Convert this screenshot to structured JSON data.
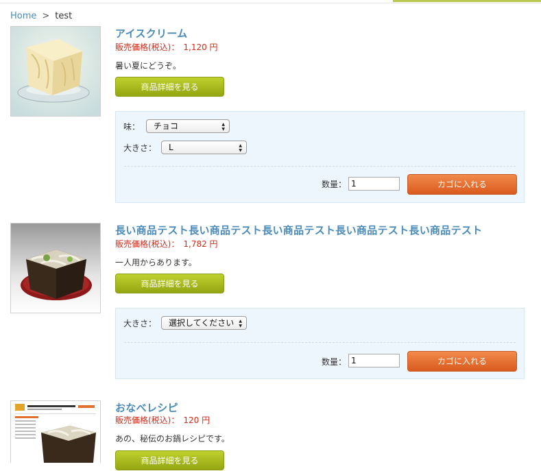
{
  "breadcrumb": {
    "home": "Home",
    "sep": ">",
    "current": "test"
  },
  "products": [
    {
      "name": "アイスクリーム",
      "price_label": "販売価格(税込)：",
      "price_value": "1,120 円",
      "description": "暑い夏にどうぞ。",
      "detail_button": "商品詳細を見る",
      "options": [
        {
          "label": "味：",
          "selected": "チョコ"
        },
        {
          "label": "大きさ：",
          "selected": "L"
        }
      ],
      "qty_label": "数量：",
      "qty_value": "1",
      "cart_button": "カゴに入れる"
    },
    {
      "name": "長い商品テスト長い商品テスト長い商品テスト長い商品テスト長い商品テスト",
      "price_label": "販売価格(税込)：",
      "price_value": "1,782 円",
      "description": "一人用からあります。",
      "detail_button": "商品詳細を見る",
      "options": [
        {
          "label": "大きさ：",
          "selected": "選択してください"
        }
      ],
      "qty_label": "数量：",
      "qty_value": "1",
      "cart_button": "カゴに入れる"
    },
    {
      "name": "おなべレシピ",
      "price_label": "販売価格(税込)：",
      "price_value": "120 円",
      "description": "あの、秘伝のお鍋レシピです。",
      "detail_button": "商品詳細を見る"
    }
  ],
  "colors": {
    "link": "#4a8ab8",
    "price": "#d22b1b",
    "detail_btn": "#a9bb1c",
    "cart_btn": "#e46f30",
    "cart_box": "#eef6fd"
  }
}
